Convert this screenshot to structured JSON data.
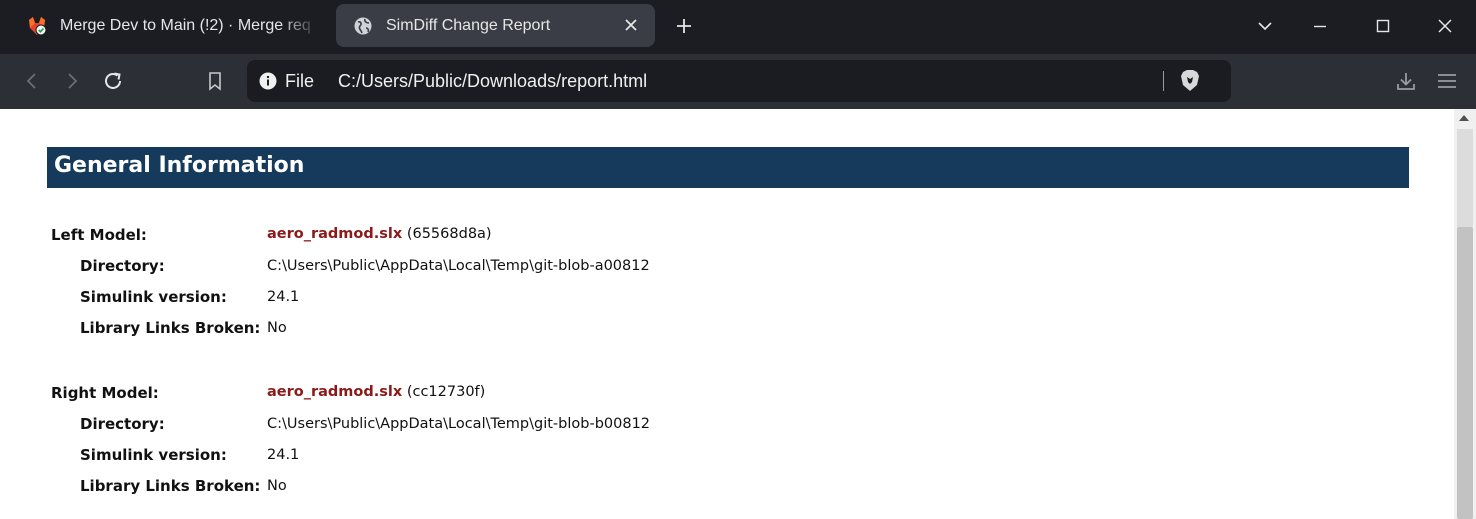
{
  "browser": {
    "tabs": [
      {
        "title": "Merge Dev to Main (!2) · Merge req",
        "active": false,
        "icon": "gitlab-fox-icon"
      },
      {
        "title": "SimDiff Change Report",
        "active": true,
        "icon": "globe-icon"
      }
    ],
    "address": {
      "scheme_label": "File",
      "url": "C:/Users/Public/Downloads/report.html"
    }
  },
  "report": {
    "section_title": "General Information",
    "left": {
      "label": "Left Model:",
      "file": "aero_radmod.slx",
      "hash": "(65568d8a)",
      "directory_label": "Directory:",
      "directory": "C:\\Users\\Public\\AppData\\Local\\Temp\\git-blob-a00812",
      "version_label": "Simulink version:",
      "version": "24.1",
      "links_label": "Library Links Broken:",
      "links": "No"
    },
    "right": {
      "label": "Right Model:",
      "file": "aero_radmod.slx",
      "hash": "(cc12730f)",
      "directory_label": "Directory:",
      "directory": "C:\\Users\\Public\\AppData\\Local\\Temp\\git-blob-b00812",
      "version_label": "Simulink version:",
      "version": "24.1",
      "links_label": "Library Links Broken:",
      "links": "No"
    }
  },
  "colors": {
    "header_bg": "#163a5c",
    "link": "#8b1a1a",
    "tabbar_bg": "#1b1d23",
    "toolbar_bg": "#2c2f36"
  }
}
